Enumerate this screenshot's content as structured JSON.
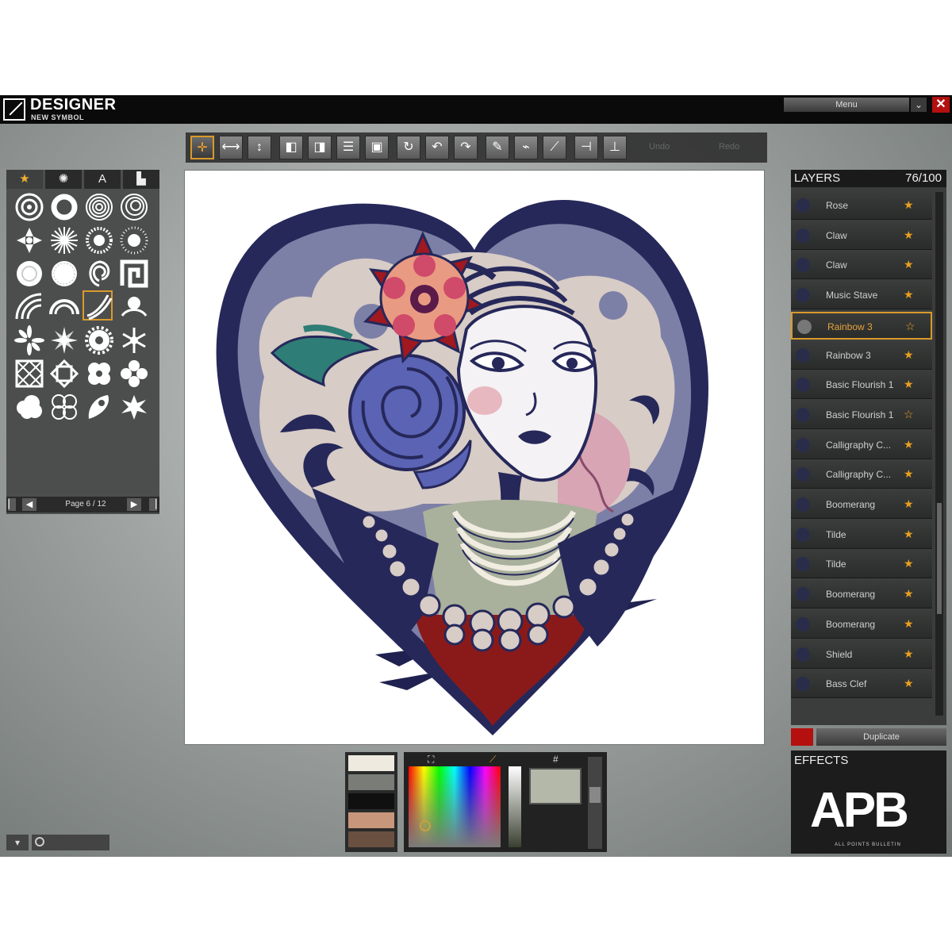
{
  "titlebar": {
    "title": "DESIGNER",
    "subtitle": "NEW SYMBOL",
    "menu_label": "Menu",
    "close_label": "✕",
    "chevron": "⌄"
  },
  "toolbar": {
    "disabled_labels": [
      "Undo",
      "Redo"
    ],
    "tools": [
      "move-icon",
      "scale-horizontal-icon",
      "scale-vertical-icon",
      "layer-front-icon",
      "layer-back-icon",
      "align-icon",
      "group-icon",
      "rotate-icon",
      "rotate-left-icon",
      "rotate-right-icon",
      "pen-icon",
      "brush-icon",
      "eyedropper-icon",
      "flip-horizontal-icon",
      "flip-vertical-icon"
    ]
  },
  "palette": {
    "tabs": [
      "★",
      "✺",
      "A",
      "▙"
    ],
    "page_label": "Page 6 / 12"
  },
  "layers": {
    "title": "LAYERS",
    "count": "76/100",
    "items": [
      {
        "name": "Rose",
        "starred": true
      },
      {
        "name": "Claw",
        "starred": true
      },
      {
        "name": "Claw",
        "starred": true
      },
      {
        "name": "Music Stave",
        "starred": true
      },
      {
        "name": "Rainbow 3",
        "starred": false,
        "selected": true
      },
      {
        "name": "Rainbow 3",
        "starred": true
      },
      {
        "name": "Basic Flourish 1",
        "starred": true
      },
      {
        "name": "Basic Flourish 1",
        "starred": false
      },
      {
        "name": "Calligraphy C...",
        "starred": true
      },
      {
        "name": "Calligraphy C...",
        "starred": true
      },
      {
        "name": "Boomerang",
        "starred": true
      },
      {
        "name": "Tilde",
        "starred": true
      },
      {
        "name": "Tilde",
        "starred": true
      },
      {
        "name": "Boomerang",
        "starred": true
      },
      {
        "name": "Boomerang",
        "starred": true
      },
      {
        "name": "Shield",
        "starred": true
      },
      {
        "name": "Bass Clef",
        "starred": true
      }
    ],
    "duplicate_label": "Duplicate"
  },
  "effects": {
    "title": "EFFECTS",
    "logo": "APB",
    "logo_tagline": "ALL POINTS BULLETIN"
  },
  "color": {
    "hex_label": "#",
    "swatches": [
      "#eeeae0",
      "#7a7c78",
      "#101010",
      "#c8967a",
      "#6a5040"
    ],
    "preview": "#b4b8a8"
  },
  "colors": {
    "accent": "#d99a2a",
    "navy": "#26285a",
    "periwinkle": "#7d80a6",
    "cream": "#d7ccc6",
    "red": "#8a1a1a"
  }
}
